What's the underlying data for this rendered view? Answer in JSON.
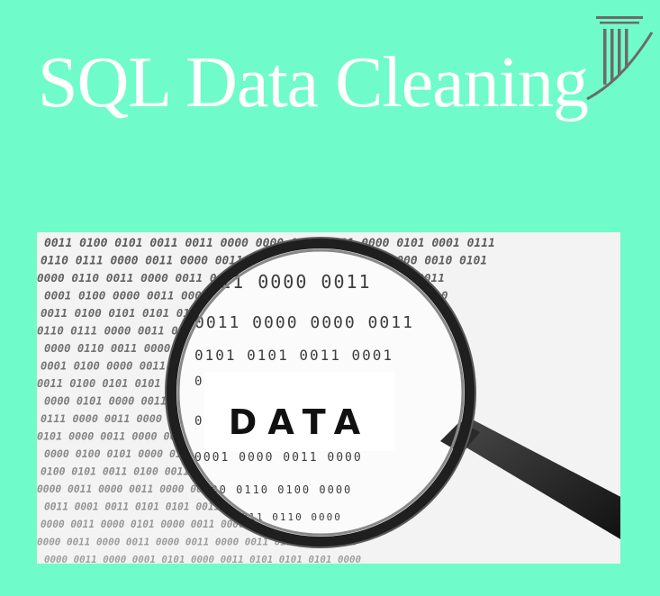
{
  "header": {
    "title": "SQL Data Cleaning"
  },
  "logo": {
    "icon": "column-pillar-icon",
    "color": "#6b6b6b"
  },
  "photo": {
    "label": "DATA",
    "binary_rows": [
      "0011 0100 0101 0011 0011 0000 0000 0101 0011 0000 0101 0001 0111",
      "0110 0111 0000 0011 0000 0011 0000 0011 0000 0011 0000 0010 0101",
      "0000 0110 0011 0000 0011 0000 0000 0011 0000 0011 0000 0011",
      "0001 0100 0000 0011 0000 0000 0011 0000 0000 0000 0001 0010",
      "0011 0100 0101 0101 0101 0011 0001 0101 0101 0001 0010",
      "0110 0111 0000 0011 0000 0011 0000 0011 0000 0000 0001 0000",
      "0000 0110 0011 0000 0011 0000 0000 0011 0000 0011 0100 0000",
      "0001 0100 0000 0011 0000 0000 0011 0000 0000 0000 0001 0100",
      "0011 0100 0101 0101 0101 0011 0001 0101 0111 0111 0000 0011",
      "0000 0101 0000 0011 0000 0111 0110 0000 0101 0101 0101",
      "0111 0000 0011 0000 0011 0000 0011 0000 0000 0100 0000 0101",
      "0101 0000 0011 0000 0011 0101 0100 0000 0011 0000 0011",
      "0000 0100 0101 0000 0110 0100 0000 0101 0000 0011 0000",
      "0100 0101 0011 0100 0011 0111 0000 0011 0000 0011 0000",
      "0000 0011 0000 0011 0000 0000 0011 0000 0000 0010 0000",
      "0011 0001 0011 0101 0101 0011 0011 0001 0011 0100",
      "0000 0011 0000 0101 0000 0011 0000 0011 0001 0000 0000",
      "0000 0011 0000 0011 0000 0011 0000 0011 0111 0111 0010",
      "0000 0011 0000 0001 0101 0000 0011 0101 0101 0101 0000"
    ],
    "lens_rows": [
      "0111 0000 0011",
      "0011 0000 0000 0011",
      "0101 0101 0011 0001",
      "0000 0000 0111",
      "0011 0000 0110",
      "0001 0000 0011 0000",
      "0000 0110 0100 0000",
      "0100 0011 0110 0000"
    ]
  }
}
